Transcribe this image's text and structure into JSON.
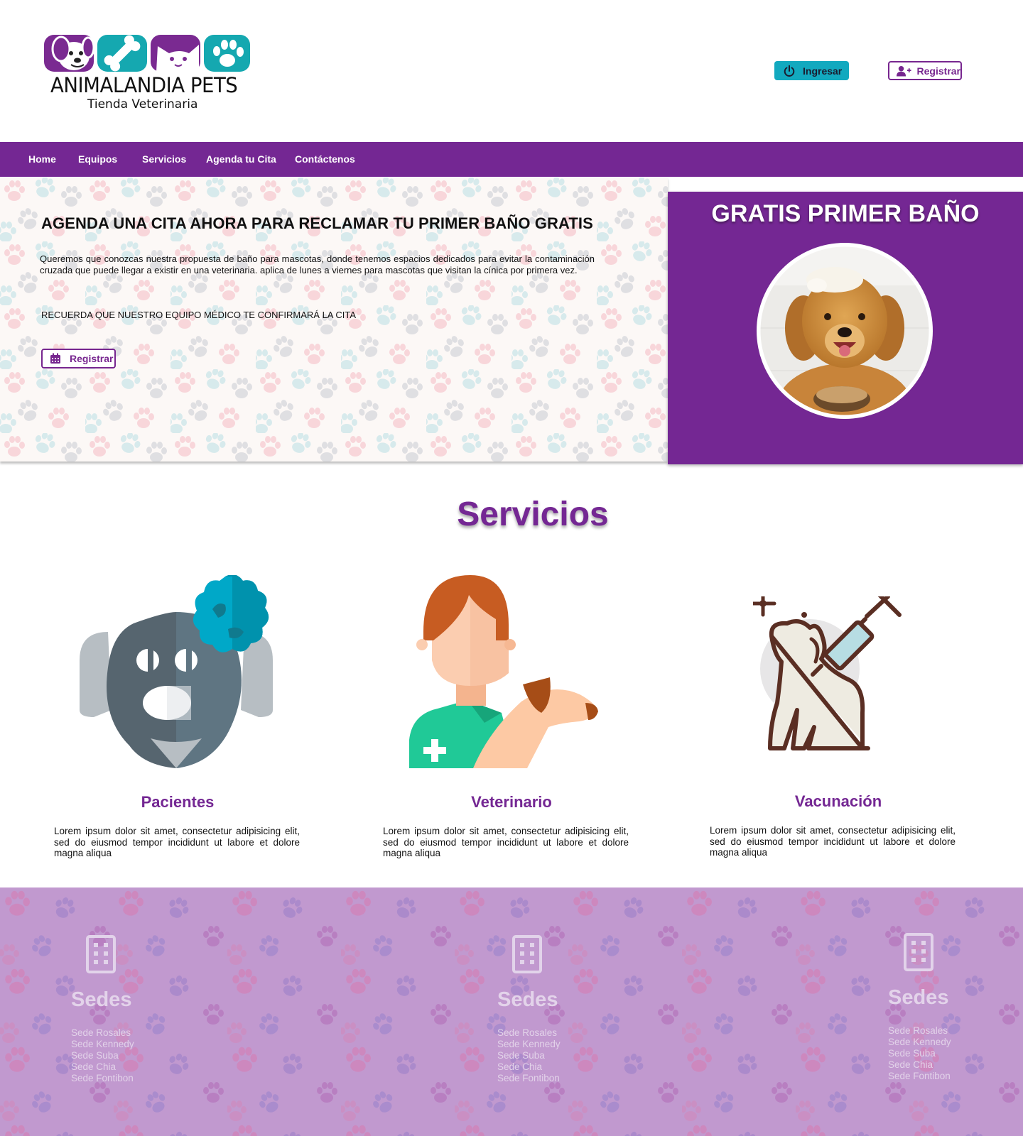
{
  "brand": {
    "name": "ANIMALANDIA PETS",
    "tagline": "Tienda Veterinaria",
    "colors": {
      "purple": "#742793",
      "teal": "#12a9bf"
    }
  },
  "header": {
    "login_button": {
      "label": "Ingresar",
      "icon": "power-icon"
    },
    "register_button": {
      "label": "Registrar",
      "icon": "user-plus-icon"
    }
  },
  "nav": {
    "items": [
      {
        "label": "Home"
      },
      {
        "label": "Equipos"
      },
      {
        "label": "Servicios"
      },
      {
        "label": "Agenda tu Cita"
      },
      {
        "label": "Contáctenos"
      }
    ]
  },
  "hero": {
    "title": "AGENDA UNA CITA AHORA PARA RECLAMAR TU PRIMER BAÑO GRATIS",
    "text": "Queremos que conozcas nuestra propuesta de baño para mascotas, donde tenemos espacios dedicados para evitar la contaminación cruzada que puede llegar a existir en una veterinaria. aplica de lunes a viernes para mascotas que visitan la cínica por primera vez.",
    "note": "RECUERDA QUE NUESTRO EQUIPO MÉDICO TE CONFIRMARÁ LA CITA",
    "button": {
      "label": "Registrar",
      "icon": "calendar-icon"
    }
  },
  "promo": {
    "title": "GRATIS PRIMER BAÑO",
    "image": "golden-retriever-bath-photo"
  },
  "services": {
    "title": "Servicios",
    "items": [
      {
        "name": "Pacientes",
        "icon": "dog-patient-icon",
        "text": "Lorem ipsum dolor sit amet, consectetur adipisicing elit, sed do eiusmod tempor incididunt ut labore et dolore magna aliqua"
      },
      {
        "name": "Veterinario",
        "icon": "veterinarian-icon",
        "text": "Lorem ipsum dolor sit amet, consectetur adipisicing elit, sed do eiusmod tempor incididunt ut labore et dolore magna aliqua"
      },
      {
        "name": "Vacunación",
        "icon": "vaccination-icon",
        "text": "Lorem ipsum dolor sit amet, consectetur adipisicing elit, sed do eiusmod tempor incididunt ut labore et dolore magna aliqua"
      }
    ]
  },
  "footer": {
    "sedes": [
      {
        "title": "Sedes",
        "icon": "building-icon",
        "locations": [
          "Sede Rosales",
          "Sede Kennedy",
          "Sede Suba",
          "Sede Chia",
          "Sede Fontibon"
        ]
      },
      {
        "title": "Sedes",
        "icon": "building-icon",
        "locations": [
          "Sede Rosales",
          "Sede Kennedy",
          "Sede Suba",
          "Sede Chia",
          "Sede Fontibon"
        ]
      },
      {
        "title": "Sedes",
        "icon": "building-icon",
        "locations": [
          "Sede Rosales",
          "Sede Kennedy",
          "Sede Suba",
          "Sede Chia",
          "Sede Fontibon"
        ]
      }
    ]
  }
}
